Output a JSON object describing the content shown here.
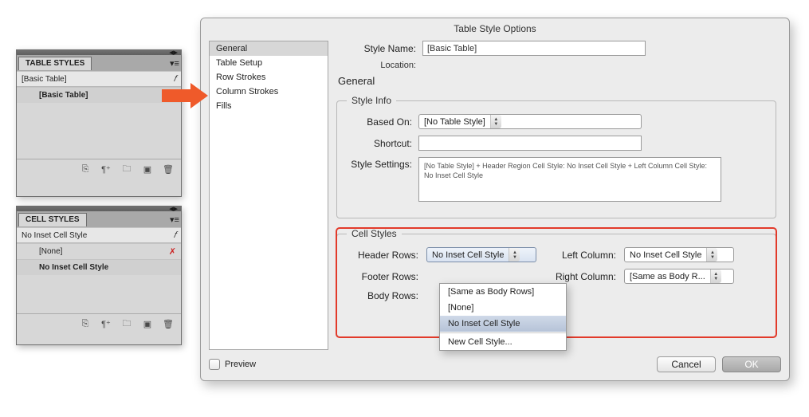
{
  "panels": {
    "table_styles": {
      "tab": "TABLE STYLES",
      "header_item": "[Basic Table]",
      "selected_item": "[Basic Table]"
    },
    "cell_styles": {
      "tab": "CELL STYLES",
      "header_item": "No Inset Cell Style",
      "item_none": "[None]",
      "selected_item": "No Inset Cell Style"
    }
  },
  "dialog": {
    "title": "Table Style Options",
    "sidebar": [
      "General",
      "Table Setup",
      "Row Strokes",
      "Column Strokes",
      "Fills"
    ],
    "style_name_label": "Style Name:",
    "style_name_value": "[Basic Table]",
    "location_label": "Location:",
    "section": "General",
    "style_info": {
      "legend": "Style Info",
      "based_on_label": "Based On:",
      "based_on_value": "[No Table Style]",
      "shortcut_label": "Shortcut:",
      "shortcut_value": "",
      "settings_label": "Style Settings:",
      "settings_text": "[No Table Style] + Header Region Cell Style: No Inset Cell Style + Left Column Cell Style: No Inset Cell Style"
    },
    "cell_styles": {
      "legend": "Cell Styles",
      "header_rows_label": "Header Rows:",
      "header_rows_value": "No Inset Cell Style",
      "footer_rows_label": "Footer Rows:",
      "body_rows_label": "Body Rows:",
      "left_col_label": "Left Column:",
      "left_col_value": "No Inset Cell Style",
      "right_col_label": "Right Column:",
      "right_col_value": "[Same as Body R..."
    },
    "dropdown": {
      "items": [
        "[Same as Body Rows]",
        "[None]",
        "No Inset Cell Style",
        "New Cell Style..."
      ]
    },
    "preview_label": "Preview",
    "cancel_label": "Cancel",
    "ok_label": "OK"
  }
}
